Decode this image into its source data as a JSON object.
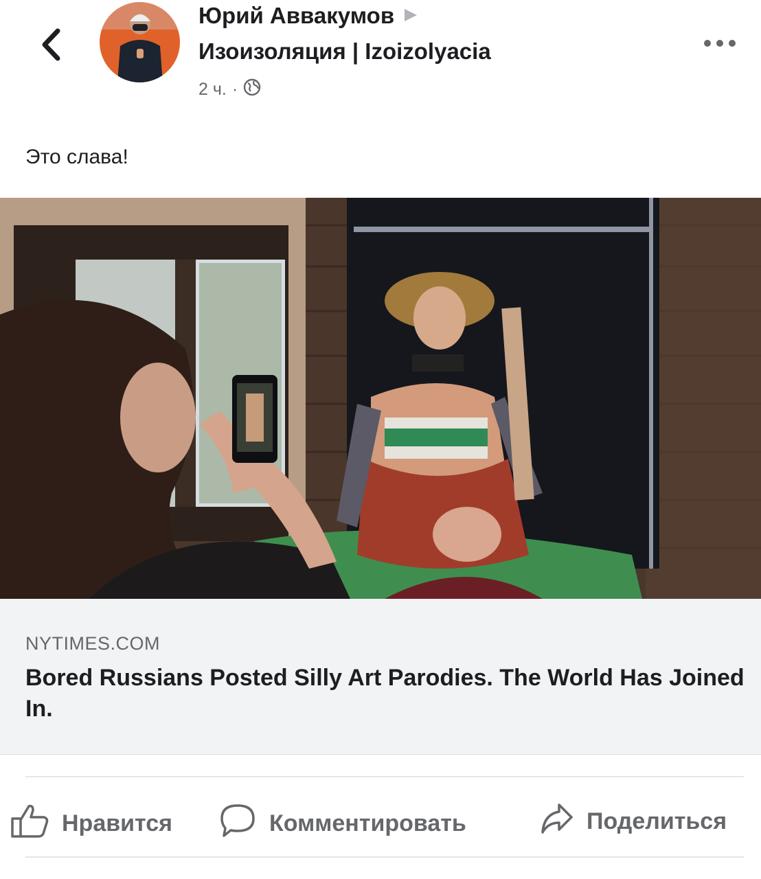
{
  "header": {
    "author": "Юрий Аввакумов",
    "group": "Изоизоляция | Izoizolyacia",
    "time": "2 ч.",
    "separator": "·"
  },
  "post": {
    "text": "Это слава!"
  },
  "link": {
    "domain": "NYTIMES.COM",
    "title": "Bored Russians Posted Silly Art Parodies. The World Has Joined In."
  },
  "actions": {
    "like": "Нравится",
    "comment": "Комментировать",
    "share": "Поделиться"
  },
  "icons": {
    "back": "chevron-left-icon",
    "more": "more-horizontal-icon",
    "audience": "globe-icon",
    "arrow": "triangle-right-icon",
    "like": "thumbs-up-icon",
    "comment": "speech-bubble-icon",
    "share": "share-arrow-icon"
  },
  "colors": {
    "text_primary": "#1c1e21",
    "text_secondary": "#65676b",
    "link_box_bg": "#f2f3f5",
    "avatar_bg": "#e0622a"
  }
}
